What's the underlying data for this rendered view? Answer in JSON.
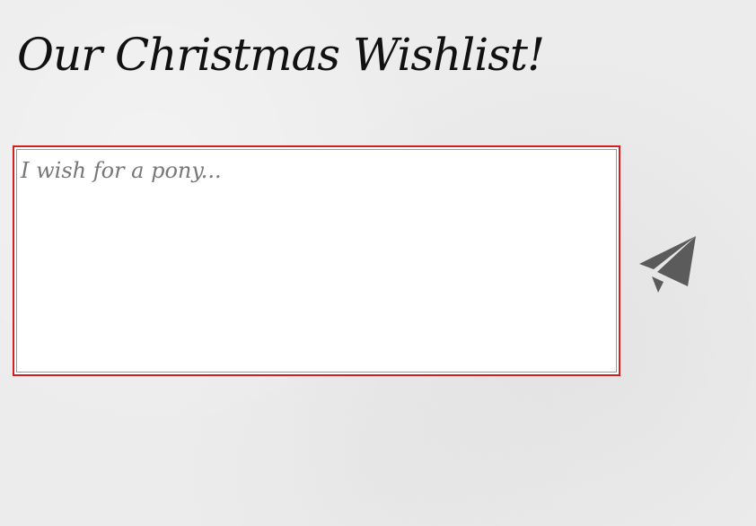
{
  "header": {
    "title": "Our Christmas Wishlist!"
  },
  "wishlist": {
    "input_value": "",
    "input_placeholder": "I wish for a pony..."
  },
  "send": {
    "icon": "paper-plane-icon",
    "color": "#5b5b5b"
  },
  "theme": {
    "background": "#ececec",
    "frame_border": "#d41f1f"
  }
}
